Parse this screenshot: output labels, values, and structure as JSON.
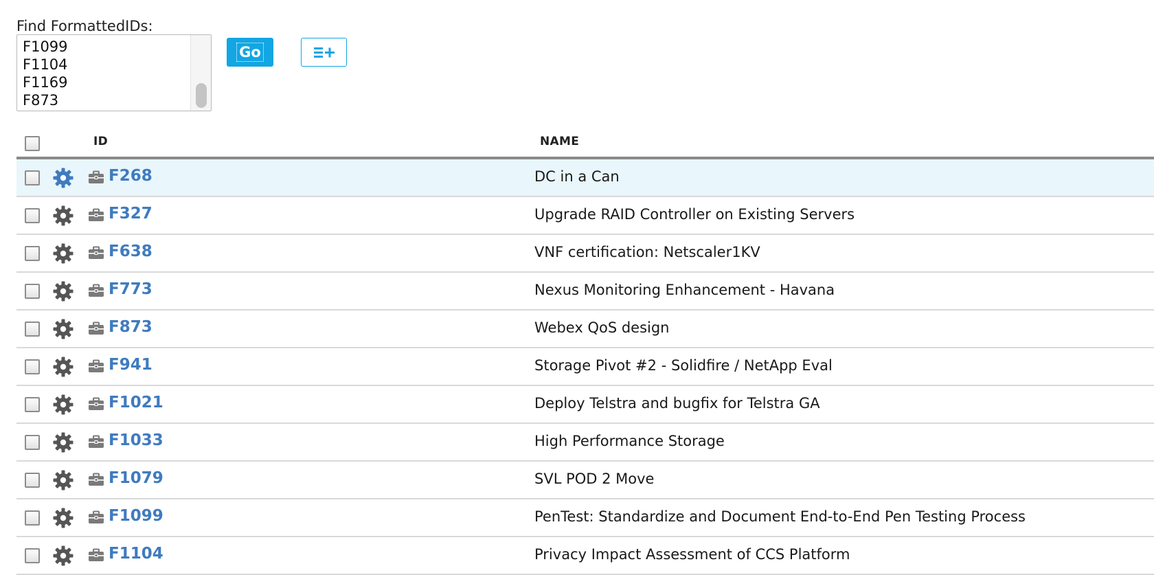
{
  "finder": {
    "label": "Find FormattedIDs:",
    "ids": [
      "F1099",
      "F1104",
      "F1169",
      "F873"
    ],
    "go_label": "Go",
    "add_icon": "list-add-icon"
  },
  "grid": {
    "headers": {
      "id": "ID",
      "name": "NAME"
    },
    "rows": [
      {
        "id": "F268",
        "name": "DC in a Can",
        "selected": true
      },
      {
        "id": "F327",
        "name": "Upgrade RAID Controller on Existing Servers"
      },
      {
        "id": "F638",
        "name": "VNF certification: Netscaler1KV"
      },
      {
        "id": "F773",
        "name": "Nexus Monitoring Enhancement - Havana"
      },
      {
        "id": "F873",
        "name": "Webex QoS design"
      },
      {
        "id": "F941",
        "name": "Storage Pivot #2 - Solidfire / NetApp Eval"
      },
      {
        "id": "F1021",
        "name": "Deploy Telstra and bugfix for Telstra GA"
      },
      {
        "id": "F1033",
        "name": "High Performance Storage"
      },
      {
        "id": "F1079",
        "name": "SVL POD 2 Move"
      },
      {
        "id": "F1099",
        "name": "PenTest: Standardize and Document End-to-End Pen Testing Process"
      },
      {
        "id": "F1104",
        "name": "Privacy Impact Assessment of CCS Platform"
      }
    ]
  },
  "colors": {
    "accent": "#12a6e3",
    "link": "#3f7bbf",
    "selected_row": "#e9f6fb",
    "gear_active": "#3f7bbf",
    "gear": "#555555"
  }
}
